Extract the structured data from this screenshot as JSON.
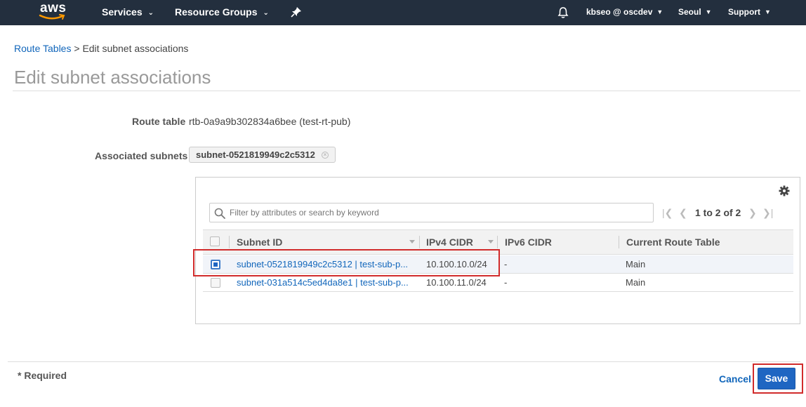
{
  "nav": {
    "logo_text": "aws",
    "services": "Services",
    "resource_groups": "Resource Groups",
    "user": "kbseo @ oscdev",
    "region": "Seoul",
    "support": "Support"
  },
  "breadcrumb": {
    "root": "Route Tables",
    "separator": ">",
    "current": "Edit subnet associations"
  },
  "page_title": "Edit subnet associations",
  "form": {
    "route_table_label": "Route table",
    "route_table_value": "rtb-0a9a9b302834a6bee (test-rt-pub)",
    "associated_subnets_label": "Associated subnets",
    "associated_subnet_token": "subnet-0521819949c2c5312"
  },
  "table": {
    "search_placeholder": "Filter by attributes or search by keyword",
    "pagination": "1 to 2 of 2",
    "columns": [
      "Subnet ID",
      "IPv4 CIDR",
      "IPv6 CIDR",
      "Current Route Table"
    ],
    "rows": [
      {
        "subnet_id": "subnet-0521819949c2c5312 | test-sub-p...",
        "ipv4": "10.100.10.0/24",
        "ipv6": "-",
        "route_table": "Main",
        "selected": true
      },
      {
        "subnet_id": "subnet-031a514c5ed4da8e1 | test-sub-p...",
        "ipv4": "10.100.11.0/24",
        "ipv6": "-",
        "route_table": "Main",
        "selected": false
      }
    ]
  },
  "footer": {
    "required": "* Required",
    "cancel": "Cancel",
    "save": "Save"
  },
  "colors": {
    "nav_bg": "#232f3e",
    "link": "#1166bb",
    "primary_button": "#1f66c2",
    "highlight_box": "#d12b2b"
  }
}
